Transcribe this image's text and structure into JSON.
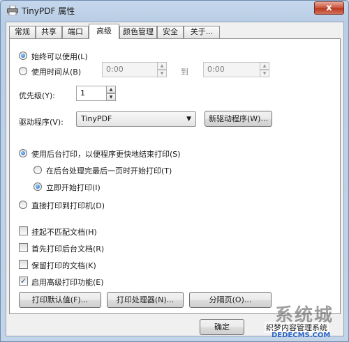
{
  "window": {
    "title": "TinyPDF 属性",
    "close_label": "x"
  },
  "tabs": [
    {
      "label": "常规"
    },
    {
      "label": "共享"
    },
    {
      "label": "端口"
    },
    {
      "label": "高级",
      "active": true
    },
    {
      "label": "颜色管理"
    },
    {
      "label": "安全"
    },
    {
      "label": "关于..."
    }
  ],
  "availability": {
    "always_label": "始终可以使用(L)",
    "always_selected": true,
    "from_label": "使用时间从(B)",
    "from_selected": false,
    "start_time": "0:00",
    "to_label": "到",
    "end_time": "0:00"
  },
  "priority": {
    "label": "优先级(Y):",
    "value": "1"
  },
  "driver": {
    "label": "驱动程序(V):",
    "selected": "TinyPDF",
    "new_driver_button": "新驱动程序(W)..."
  },
  "spooling": {
    "spool_label": "使用后台打印，以便程序更快地结束打印(S)",
    "spool_selected": true,
    "after_last_page_label": "在后台处理完最后一页时开始打印(T)",
    "after_last_page_selected": false,
    "immediately_label": "立即开始打印(I)",
    "immediately_selected": true,
    "direct_label": "直接打印到打印机(D)",
    "direct_selected": false
  },
  "options": [
    {
      "label": "挂起不匹配文档(H)",
      "checked": false
    },
    {
      "label": "首先打印后台文档(R)",
      "checked": false
    },
    {
      "label": "保留打印的文档(K)",
      "checked": false
    },
    {
      "label": "启用高级打印功能(E)",
      "checked": true
    }
  ],
  "buttons": {
    "defaults": "打印默认值(F)...",
    "processor": "打印处理器(N)...",
    "separator_page": "分隔页(O)...",
    "ok": "确定"
  },
  "watermark": {
    "brand": "系统城",
    "text": "织梦内容管理系统",
    "url": "DEDECMS.COM"
  }
}
